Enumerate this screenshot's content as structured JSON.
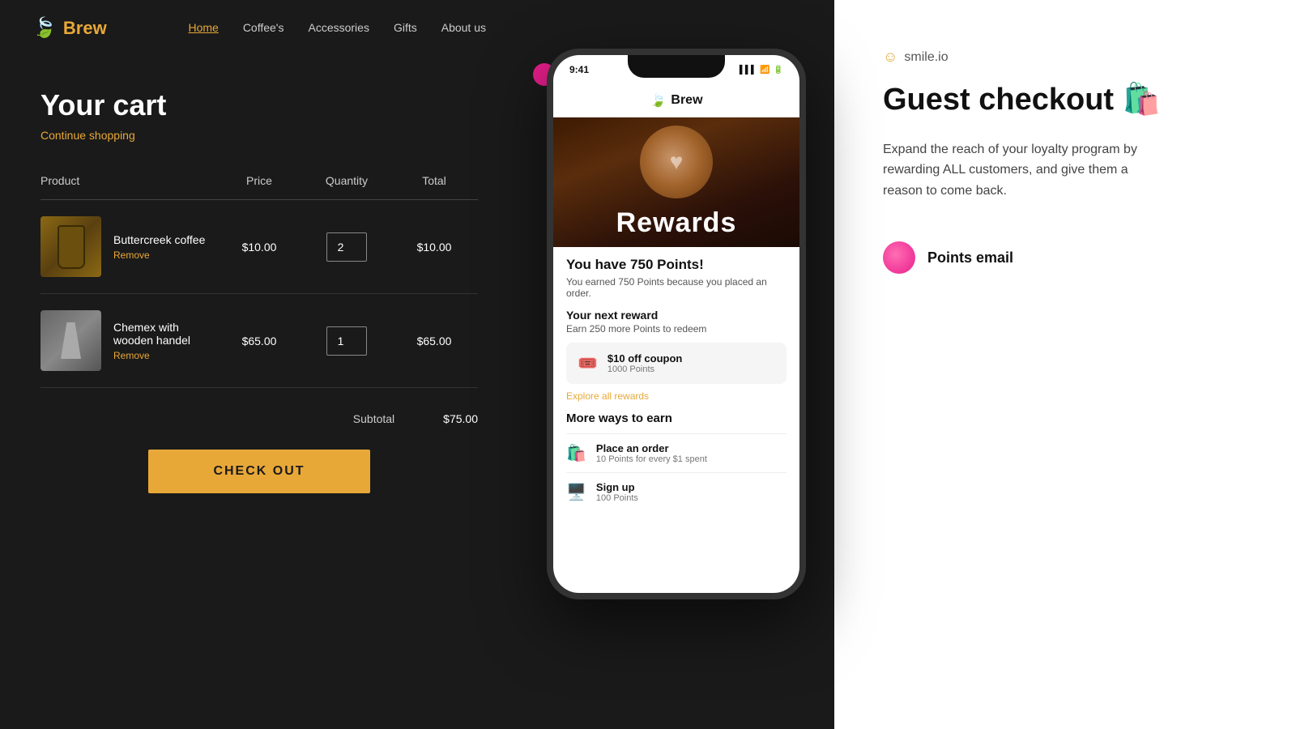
{
  "brand": {
    "name": "Brew",
    "leaf": "🍃"
  },
  "nav": {
    "links": [
      {
        "label": "Home",
        "active": true
      },
      {
        "label": "Coffee's",
        "active": false
      },
      {
        "label": "Accessories",
        "active": false
      },
      {
        "label": "Gifts",
        "active": false
      },
      {
        "label": "About us",
        "active": false
      }
    ]
  },
  "cart": {
    "title": "Your cart",
    "continue_shopping": "Continue shopping",
    "columns": {
      "product": "Product",
      "price": "Price",
      "quantity": "Quantity",
      "total": "Total"
    },
    "items": [
      {
        "name": "Buttercreek coffee",
        "price": "$10.00",
        "quantity": 2,
        "total": "$10.00",
        "remove": "Remove",
        "type": "coffee-bag"
      },
      {
        "name": "Chemex with wooden handel",
        "price": "$65.00",
        "quantity": 1,
        "total": "$65.00",
        "remove": "Remove",
        "type": "chemex"
      }
    ],
    "subtotal_label": "Subtotal",
    "subtotal_amount": "$75.00",
    "checkout_label": "CHECK OUT"
  },
  "phone": {
    "status_time": "9:41",
    "brand": "Brew",
    "rewards_hero": "Rewards",
    "points_heading": "You have 750 Points!",
    "points_desc": "You earned 750 Points because you placed an order.",
    "next_reward_title": "Your next reward",
    "next_reward_desc": "Earn 250 more Points to redeem",
    "reward_card": {
      "title": "$10 off coupon",
      "subtitle": "1000 Points"
    },
    "explore_link": "Explore all rewards",
    "more_ways_title": "More ways to earn",
    "earn_items": [
      {
        "title": "Place an order",
        "desc": "10 Points for every $1 spent"
      },
      {
        "title": "Sign up",
        "desc": "100 Points"
      }
    ]
  },
  "right": {
    "smile_io": "smile.io",
    "guest_checkout_title": "Guest checkout 🛍️",
    "guest_checkout_desc": "Expand the reach of your loyalty program by rewarding ALL customers, and give them a reason to come back.",
    "points_email_label": "Points email"
  }
}
